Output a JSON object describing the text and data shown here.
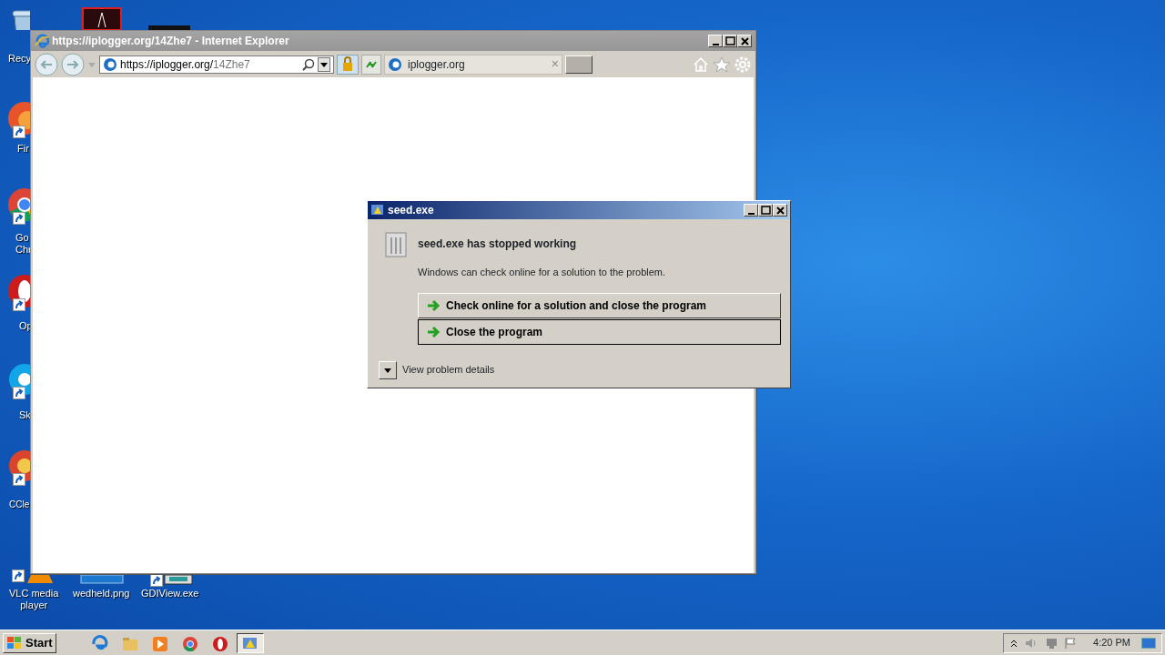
{
  "desktop_icons": [
    {
      "lines": [
        "Recy"
      ],
      "kind": "bin"
    },
    {
      "lines": [
        "Fir"
      ],
      "kind": "fox"
    },
    {
      "lines": [
        "Go",
        "Chr"
      ],
      "kind": "chrome"
    },
    {
      "lines": [
        "Op"
      ],
      "kind": "opera"
    },
    {
      "lines": [
        "Sk"
      ],
      "kind": "skype"
    },
    {
      "lines": [
        "CCle"
      ],
      "kind": "ccleaner"
    },
    {
      "lines": [
        "VLC media",
        "player"
      ],
      "kind": "vlc"
    },
    {
      "lines": [
        "wedheld.png"
      ],
      "kind": "image"
    },
    {
      "lines": [
        "GDIView.exe"
      ],
      "kind": "app"
    }
  ],
  "browser": {
    "title": "https://iplogger.org/14Zhe7 - Internet Explorer",
    "address_host": "https://iplogger.org/",
    "address_path": "14Zhe7",
    "tabs": [
      {
        "label": "iplogger.org",
        "close": "×",
        "selected": true
      }
    ]
  },
  "dialog": {
    "title": "seed.exe",
    "heading": "seed.exe has stopped working",
    "message": "Windows can check online for a solution to the problem.",
    "options": [
      {
        "label": "Check online for a solution and close the program",
        "focused": false
      },
      {
        "label": "Close the program",
        "focused": true
      }
    ],
    "details": "View problem details"
  },
  "taskbar": {
    "start": "Start",
    "apps": [
      {
        "kind": "ie",
        "active": false
      },
      {
        "kind": "folder",
        "active": false
      },
      {
        "kind": "media",
        "active": false
      },
      {
        "kind": "chrome",
        "active": false
      },
      {
        "kind": "opera",
        "active": false
      },
      {
        "kind": "error",
        "active": true
      }
    ],
    "clock": "4:20 PM"
  }
}
